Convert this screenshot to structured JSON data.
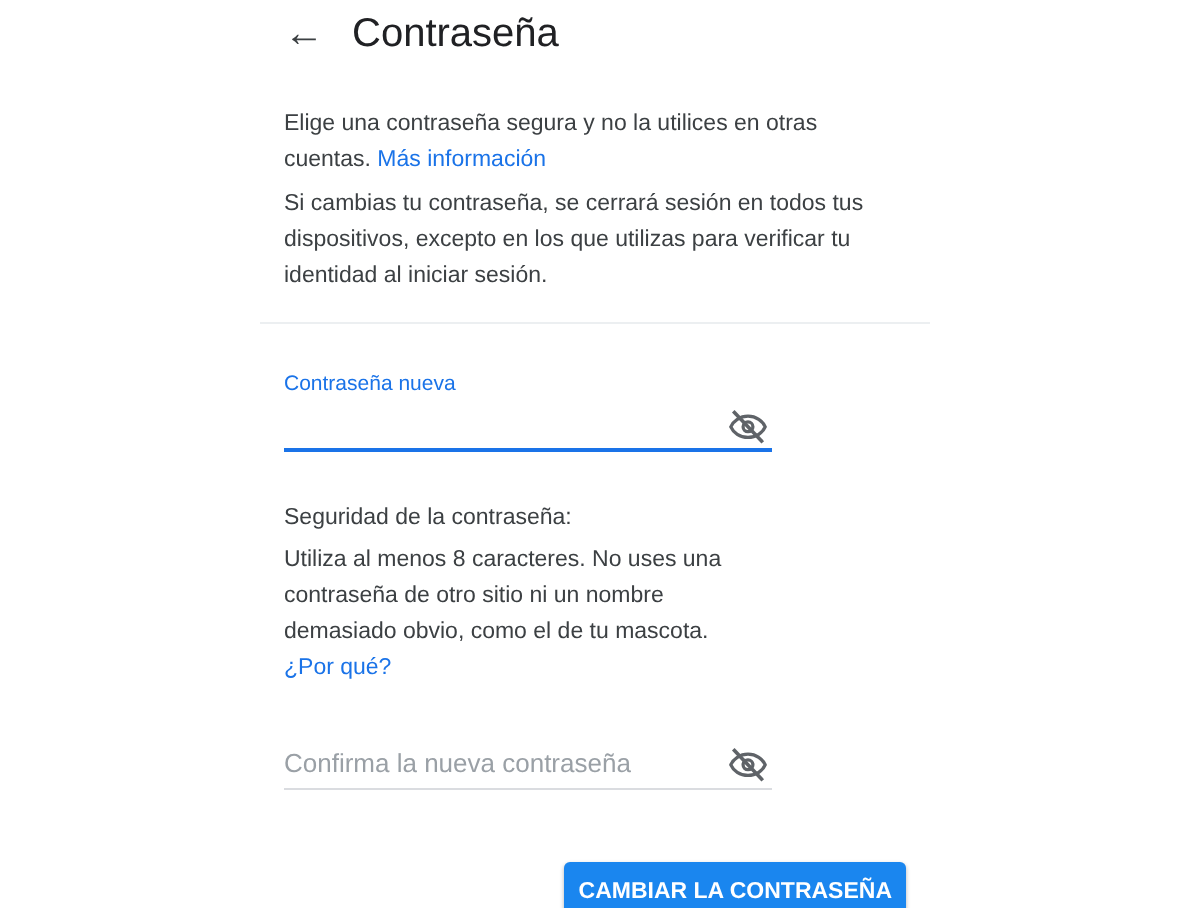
{
  "header": {
    "back_icon": "←",
    "title": "Contraseña"
  },
  "intro": {
    "text": "Elige una contraseña segura y no la utilices en otras cuentas.",
    "link": "Más información"
  },
  "notice": "Si cambias tu contraseña, se cerrará sesión en todos tus dispositivos, excepto en los que utilizas para verificar tu identidad al iniciar sesión.",
  "new_password": {
    "label": "Contraseña nueva",
    "focused": true
  },
  "strength": {
    "title": "Seguridad de la contraseña:",
    "text": "Utiliza al menos 8 caracteres. No uses una contraseña de otro sitio ni un nombre demasiado obvio, como el de tu mascota.",
    "link": "¿Por qué?"
  },
  "confirm_password": {
    "placeholder": "Confirma la nueva contraseña",
    "focused": false
  },
  "submit_button": "CAMBIAR LA CONTRASEÑA"
}
